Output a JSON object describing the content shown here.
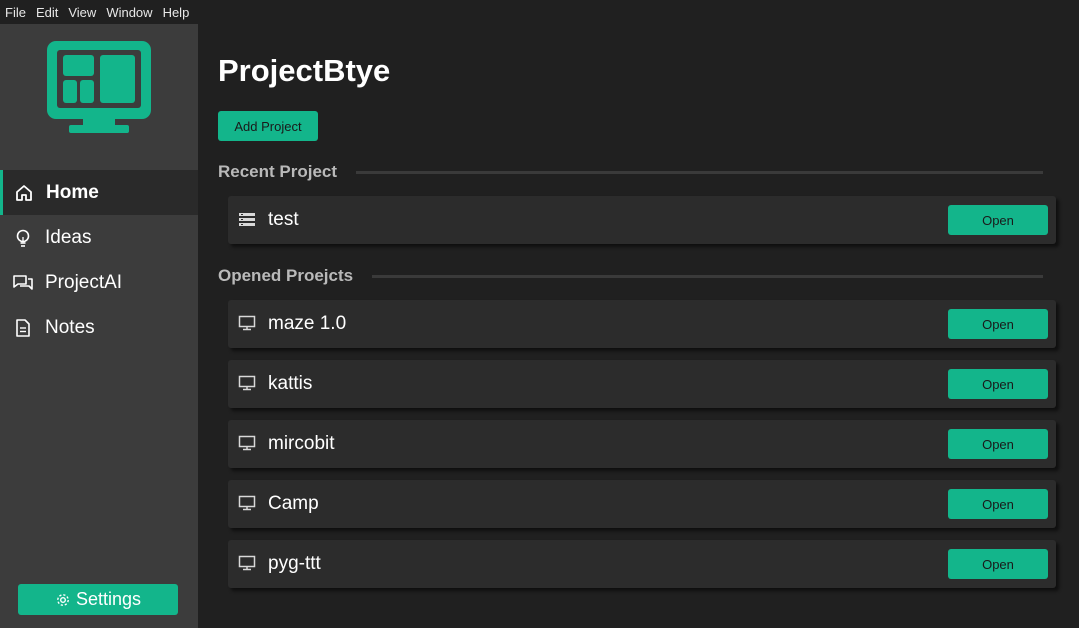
{
  "menubar": {
    "items": [
      "File",
      "Edit",
      "View",
      "Window",
      "Help"
    ]
  },
  "sidebar": {
    "nav": [
      {
        "label": "Home",
        "icon": "home-icon",
        "active": true
      },
      {
        "label": "Ideas",
        "icon": "lightbulb-icon",
        "active": false
      },
      {
        "label": "ProjectAI",
        "icon": "chat-icon",
        "active": false
      },
      {
        "label": "Notes",
        "icon": "document-icon",
        "active": false
      }
    ],
    "settings_label": "Settings"
  },
  "main": {
    "title": "ProjectBtye",
    "add_button": "Add Project",
    "recent_section": "Recent Project",
    "opened_section": "Opened Proejcts",
    "recent": [
      {
        "name": "test",
        "icon": "list-icon",
        "action": "Open"
      }
    ],
    "opened": [
      {
        "name": "maze 1.0",
        "icon": "monitor-icon",
        "action": "Open"
      },
      {
        "name": "kattis",
        "icon": "monitor-icon",
        "action": "Open"
      },
      {
        "name": "mircobit",
        "icon": "monitor-icon",
        "action": "Open"
      },
      {
        "name": "Camp",
        "icon": "monitor-icon",
        "action": "Open"
      },
      {
        "name": "pyg-ttt",
        "icon": "monitor-icon",
        "action": "Open"
      }
    ]
  },
  "colors": {
    "accent": "#13b58b",
    "sidebar": "#3c3c3c",
    "background": "#202020",
    "card": "#2c2c2c"
  }
}
